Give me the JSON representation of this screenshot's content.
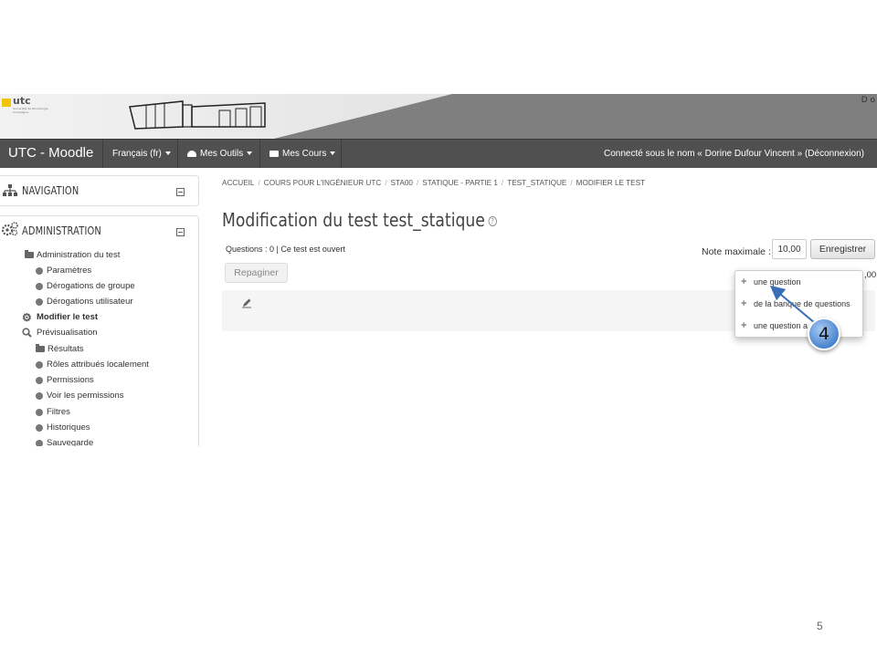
{
  "header": {
    "logo_text": "utc",
    "logo_sub": "Université de Technologie Compiègne",
    "user_initials": "D o"
  },
  "navbar": {
    "brand": "UTC - Moodle",
    "menus": [
      "Français (fr)",
      "Mes Outils",
      "Mes Cours"
    ],
    "login_info": "Connecté sous le nom « Dorine Dufour Vincent » (Déconnexion)"
  },
  "sidebar": {
    "navigation_title": "NAVIGATION",
    "administration_title": "ADMINISTRATION",
    "items": [
      {
        "label": "Administration du test",
        "icon": "folder-open-icon"
      },
      {
        "label": "Paramètres",
        "icon": "bullet-icon"
      },
      {
        "label": "Dérogations de groupe",
        "icon": "bullet-icon"
      },
      {
        "label": "Dérogations utilisateur",
        "icon": "bullet-icon"
      },
      {
        "label": "Modifier le test",
        "icon": "gear-icon"
      },
      {
        "label": "Prévisualisation",
        "icon": "search-icon"
      },
      {
        "label": "Résultats",
        "icon": "folder-icon"
      },
      {
        "label": "Rôles attribués localement",
        "icon": "bullet-icon"
      },
      {
        "label": "Permissions",
        "icon": "bullet-icon"
      },
      {
        "label": "Voir les permissions",
        "icon": "bullet-icon"
      },
      {
        "label": "Filtres",
        "icon": "bullet-icon"
      },
      {
        "label": "Historiques",
        "icon": "bullet-icon"
      },
      {
        "label": "Sauvegarde",
        "icon": "bullet-icon"
      }
    ]
  },
  "breadcrumb": [
    "ACCUEIL",
    "COURS POUR L'INGÉNIEUR UTC",
    "STA00",
    "STATIQUE - PARTIE 1",
    "TEST_STATIQUE",
    "MODIFIER LE TEST"
  ],
  "main": {
    "title": "Modification du test test_statique",
    "status": "Questions : 0 | Ce test est ouvert",
    "max_grade_label": "Note maximale :",
    "max_grade_value": "10,00",
    "save_label": "Enregistrer",
    "repaginate_label": "Repaginer",
    "total_marks": ",00"
  },
  "add_menu": {
    "items": [
      "une question",
      "de la banque de questions",
      "une question a"
    ]
  },
  "callout": {
    "number": "4",
    "color": "#4a84cf"
  },
  "slide_number": "5"
}
